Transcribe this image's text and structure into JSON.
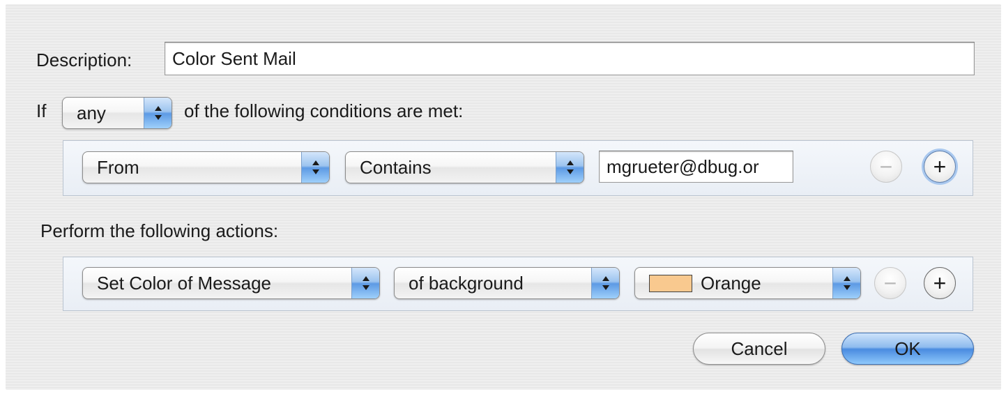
{
  "dialog": {
    "description_label": "Description:",
    "description_value": "Color Sent Mail",
    "if_label": "If",
    "match_popup_value": "any",
    "conditions_label": "of the following conditions are met:",
    "actions_label": "Perform the following actions:"
  },
  "condition_row": {
    "field_popup": "From",
    "operator_popup": "Contains",
    "value_field": "mgrueter@dbug.or",
    "remove_label": "−",
    "add_label": "+"
  },
  "action_row": {
    "action_popup": "Set Color of Message",
    "target_popup": "of background",
    "color_popup": "Orange",
    "color_swatch": "#f9c98f",
    "remove_label": "−",
    "add_label": "+"
  },
  "buttons": {
    "cancel": "Cancel",
    "ok": "OK"
  },
  "icons": {
    "popup_arrows": "up-down-chevron-icon",
    "remove": "minus-icon",
    "add": "plus-icon"
  },
  "colors": {
    "accent_blue": "#5d9ae4",
    "focus_ring": "#a9c8ef"
  }
}
